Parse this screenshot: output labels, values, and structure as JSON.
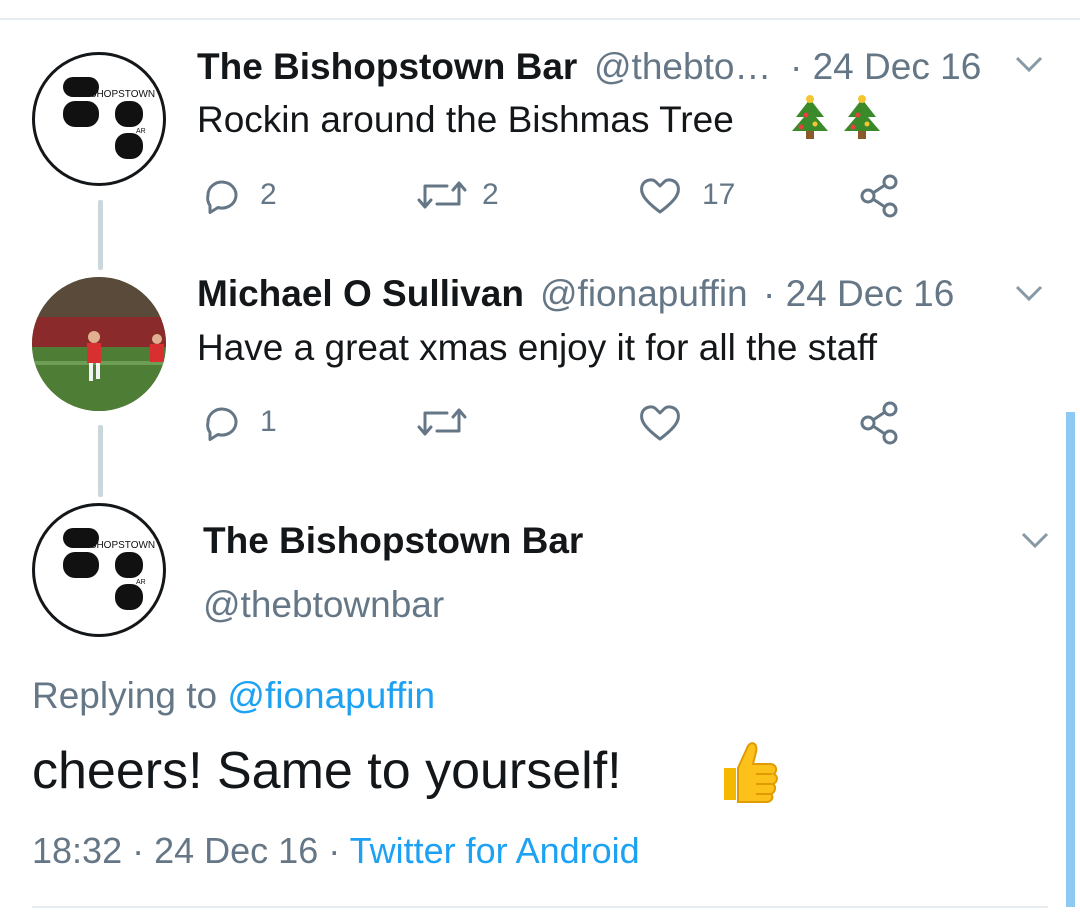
{
  "tweets": [
    {
      "name": "The Bishopstown Bar",
      "handle": "@thebto…",
      "date": "· 24 Dec 16",
      "text": "Rockin around the Bishmas Tree",
      "emojis": [
        "christmas-tree",
        "christmas-tree"
      ],
      "replies": "2",
      "retweets": "2",
      "likes": "17",
      "avatar_text": "ISHOPSTOWN",
      "avatar_subtext": "AR"
    },
    {
      "name": "Michael O Sullivan",
      "handle": "@fionapuffin",
      "date": "· 24 Dec 16",
      "text": "Have a great xmas enjoy it for all the staff",
      "replies": "1",
      "retweets": "",
      "likes": ""
    }
  ],
  "main": {
    "name": "The Bishopstown Bar",
    "handle": "@thebtownbar",
    "replying_label": "Replying to",
    "replying_handle": "@fionapuffin",
    "text": "cheers! Same to yourself!",
    "emoji": "thumbs-up",
    "time": "18:32",
    "date": "· 24 Dec 16 ·",
    "source": "Twitter for Android",
    "avatar_text": "ISHOPSTOWN",
    "avatar_subtext": "AR"
  },
  "colors": {
    "link": "#1da1f2",
    "secondary_text": "#657786",
    "primary_text": "#14171a",
    "thread_line": "#ccd6dd",
    "scrollbar": "#8ec9f3"
  }
}
